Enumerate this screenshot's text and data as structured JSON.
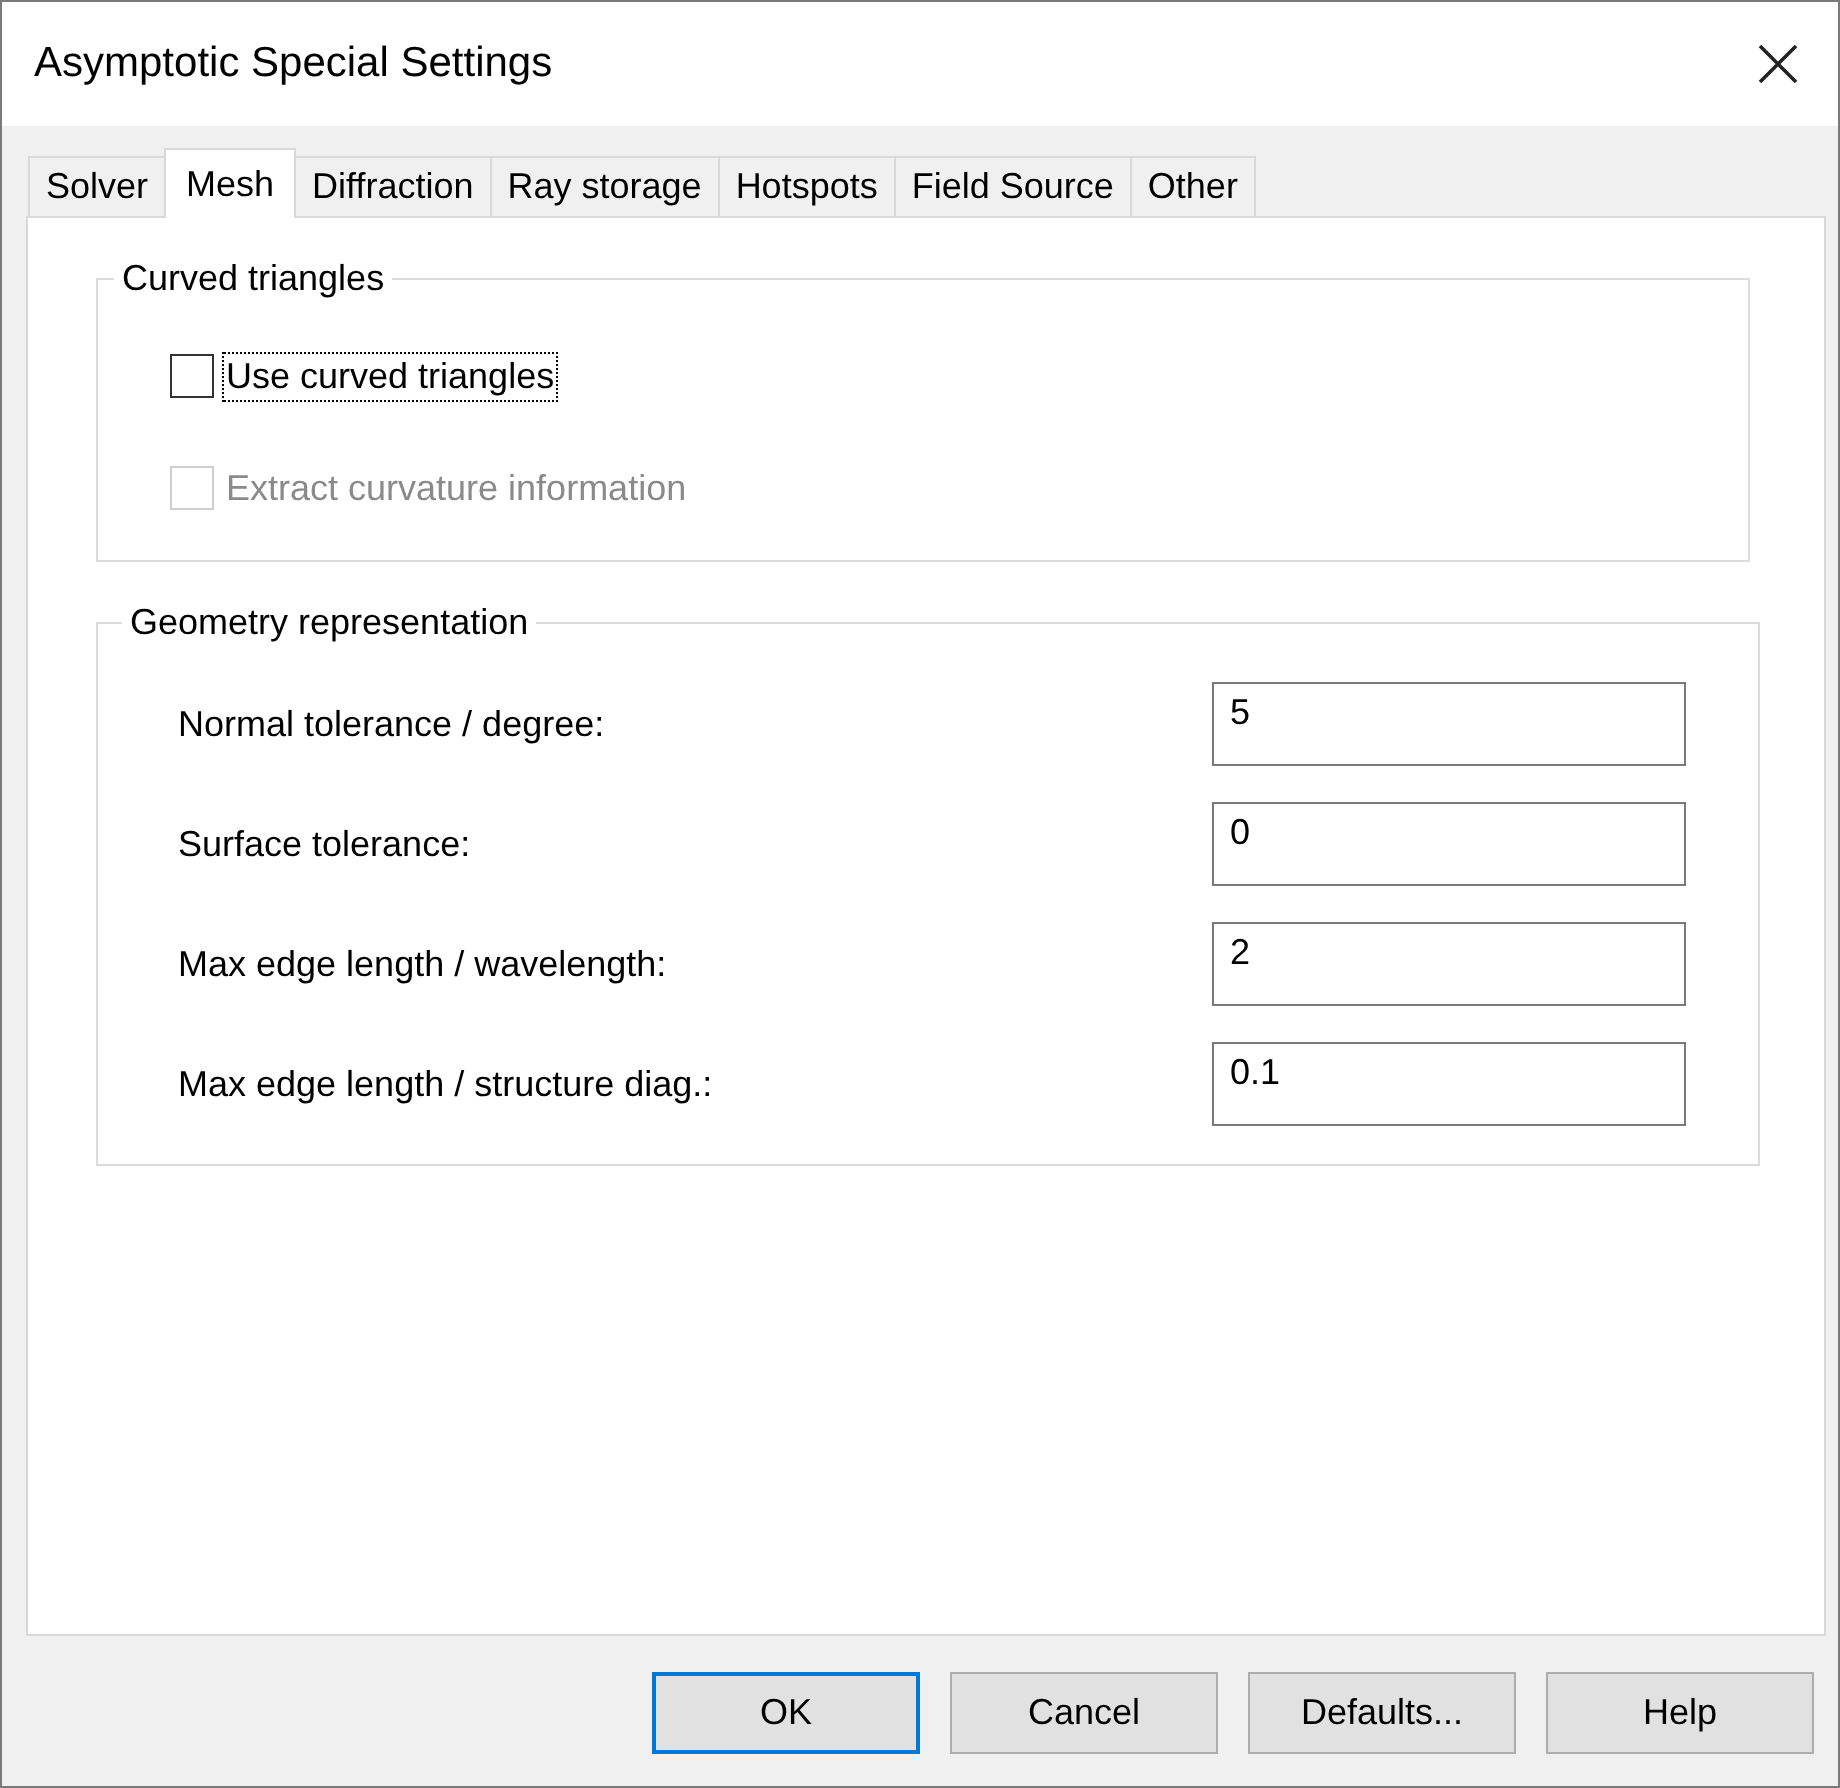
{
  "window": {
    "title": "Asymptotic Special Settings"
  },
  "tabs": [
    {
      "label": "Solver",
      "selected": false
    },
    {
      "label": "Mesh",
      "selected": true
    },
    {
      "label": "Diffraction",
      "selected": false
    },
    {
      "label": "Ray storage",
      "selected": false
    },
    {
      "label": "Hotspots",
      "selected": false
    },
    {
      "label": "Field Source",
      "selected": false
    },
    {
      "label": "Other",
      "selected": false
    }
  ],
  "groups": [
    {
      "kind": "checks",
      "title": "Curved triangles",
      "options": [
        {
          "label": "Use curved triangles",
          "checked": false,
          "disabled": false,
          "focused": true
        },
        {
          "label": "Extract curvature information",
          "checked": false,
          "disabled": true,
          "focused": false
        }
      ]
    },
    {
      "kind": "fields",
      "title": "Geometry representation",
      "fields": [
        {
          "label": "Normal tolerance / degree:",
          "value": "5"
        },
        {
          "label": "Surface tolerance:",
          "value": "0"
        },
        {
          "label": "Max edge length / wavelength:",
          "value": "2"
        },
        {
          "label": "Max edge length / structure diag.:",
          "value": "0.1"
        }
      ]
    }
  ],
  "buttons": [
    {
      "label": "OK",
      "default": true
    },
    {
      "label": "Cancel",
      "default": false
    },
    {
      "label": "Defaults...",
      "default": false
    },
    {
      "label": "Help",
      "default": false
    }
  ]
}
